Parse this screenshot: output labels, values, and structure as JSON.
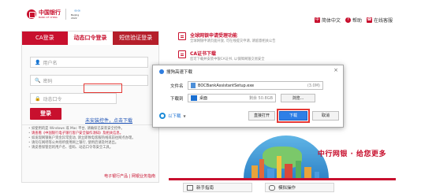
{
  "header": {
    "logo_text": "中国银行",
    "logo_subtext": "BANK OF CHINA",
    "olympic_rings": "∞∞",
    "olympic_text": "Beijing 2022",
    "links": [
      {
        "label": "简体中文",
        "icon": "language-icon",
        "color": "#c8102e"
      },
      {
        "label": "帮助",
        "icon": "help-icon",
        "color": "#c8102e"
      },
      {
        "label": "在线客服",
        "icon": "customer-service-icon",
        "color": "#c8102e"
      }
    ]
  },
  "login": {
    "tabs": [
      "CA登录",
      "动态口令登录",
      "短信验证登录"
    ],
    "active_tab": 1,
    "username_placeholder": "用户名",
    "password_placeholder": "密码",
    "otp_placeholder": "动态口令",
    "login_button": "登录",
    "download_link": "未安装控件，点击下载",
    "notes": [
      {
        "text": "如使用的是 Windows 或 Mac 平台, 请确保已安装安全控件。",
        "highlight": false
      },
      {
        "text": "请查看《中国银行电子银行客户安全操作须知》及相关信息。",
        "highlight": true
      },
      {
        "text": "如发现网银账户资金异常变动, 请立即致电客服热线或前往网点办理。",
        "highlight": false
      },
      {
        "text": "请勿在网吧等公共场所使用网上银行, 使用后请及时退出。",
        "highlight": false
      },
      {
        "text": "请妥善保管您的用户名、密码、动态口令等安全工具。",
        "highlight": false
      }
    ],
    "products_link": "电子银行产品 | 网银业务指南"
  },
  "notices": [
    {
      "title": "全球网银申请受理功能",
      "text": "全球网银申请页面开放, 可在线提交申请, 请留意相关公告"
    },
    {
      "title": "CA证书下载",
      "text": "您可下载并安装中银CA证书, 以保障网银交易安全"
    }
  ],
  "banner": {
    "slogan": "中行网银 · 给您更多"
  },
  "bottom_tabs": [
    {
      "label": "新手指南",
      "icon": "monitor-icon"
    },
    {
      "label": "模拟操作",
      "icon": "mouse-icon"
    }
  ],
  "dialog": {
    "title": "搜狗高速下载",
    "filename_label": "文件名",
    "filename_value": "BOCBankAssistantSetup.exe",
    "filesize": "(3.0M)",
    "downloadto_label": "下载到",
    "downloadto_value": "桌面",
    "free_space": "剩余 50.8GB",
    "browse_button": "浏览...",
    "open_with_label": "以下载",
    "direct_open_button": "直接打开",
    "download_button": "下载",
    "cancel_button": "取消"
  }
}
